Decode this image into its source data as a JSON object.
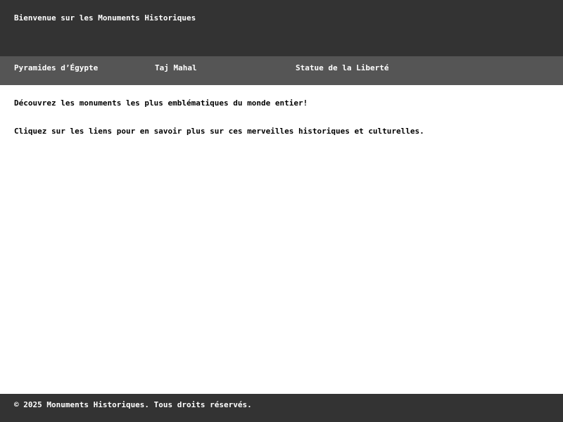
{
  "header": {
    "title": "Bienvenue sur les Monuments Historiques"
  },
  "nav": {
    "items": [
      {
        "label": "Pyramides d’Égypte"
      },
      {
        "label": "Taj Mahal"
      },
      {
        "label": "Statue de la Liberté"
      }
    ]
  },
  "main": {
    "paragraphs": [
      "Découvrez les monuments les plus emblématiques du monde entier!",
      "Cliquez sur les liens pour en savoir plus sur ces merveilles historiques et culturelles."
    ]
  },
  "footer": {
    "copyright": "© 2025 Monuments Historiques. Tous droits réservés."
  },
  "colors": {
    "header_bg": "#333333",
    "nav_bg": "#555555",
    "footer_bg": "#333333",
    "text_light": "#ffffff",
    "text_dark": "#000000"
  }
}
